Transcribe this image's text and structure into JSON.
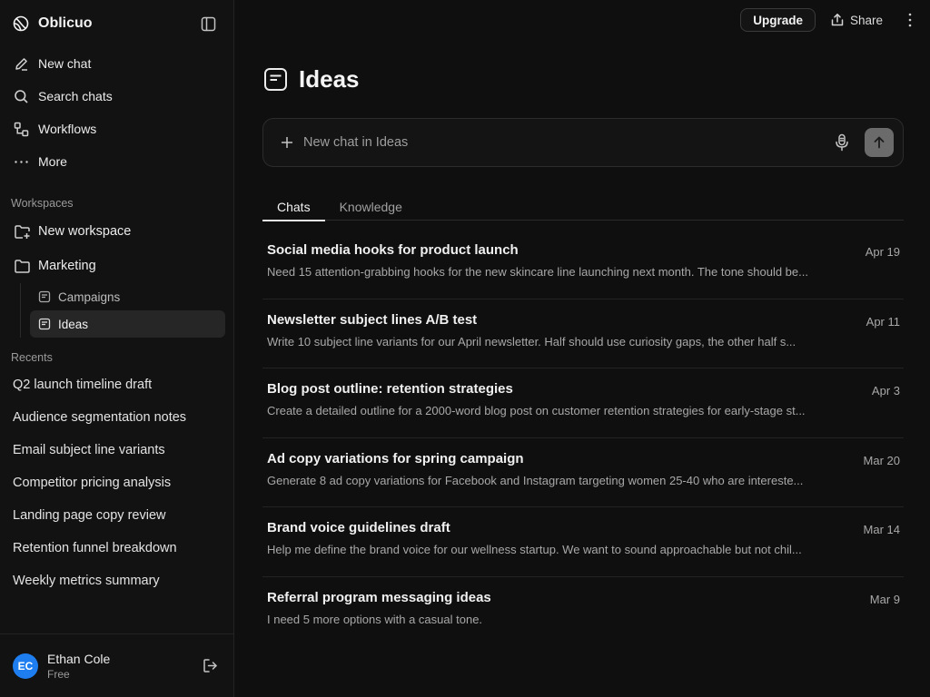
{
  "brand": {
    "name": "Oblicuo"
  },
  "nav": [
    {
      "id": "new-chat",
      "label": "New chat",
      "icon": "pencil-icon"
    },
    {
      "id": "search-chats",
      "label": "Search chats",
      "icon": "search-icon"
    },
    {
      "id": "workflows",
      "label": "Workflows",
      "icon": "workflow-icon"
    },
    {
      "id": "more",
      "label": "More",
      "icon": "ellipsis-icon"
    }
  ],
  "workspaces": {
    "label": "Workspaces",
    "new_label": "New workspace",
    "folder_label": "Marketing",
    "children": [
      {
        "label": "Campaigns",
        "active": false
      },
      {
        "label": "Ideas",
        "active": true
      }
    ]
  },
  "recents": {
    "label": "Recents",
    "items": [
      "Q2 launch timeline draft",
      "Audience segmentation notes",
      "Email subject line variants",
      "Competitor pricing analysis",
      "Landing page copy review",
      "Retention funnel breakdown",
      "Weekly metrics summary"
    ]
  },
  "user": {
    "initials": "EC",
    "name": "Ethan Cole",
    "plan": "Free",
    "avatar_color": "#1e7ef0"
  },
  "topbar": {
    "upgrade_label": "Upgrade",
    "share_label": "Share"
  },
  "page": {
    "title": "Ideas"
  },
  "composer": {
    "placeholder": "New chat in Ideas"
  },
  "tabs": [
    {
      "label": "Chats",
      "active": true
    },
    {
      "label": "Knowledge",
      "active": false
    }
  ],
  "chats": [
    {
      "title": "Social media hooks for product launch",
      "date": "Apr 19",
      "preview": "Need 15 attention-grabbing hooks for the new skincare line launching next month. The tone should be..."
    },
    {
      "title": "Newsletter subject lines A/B test",
      "date": "Apr 11",
      "preview": "Write 10 subject line variants for our April newsletter. Half should use curiosity gaps, the other half s..."
    },
    {
      "title": "Blog post outline: retention strategies",
      "date": "Apr 3",
      "preview": "Create a detailed outline for a 2000-word blog post on customer retention strategies for early-stage st..."
    },
    {
      "title": "Ad copy variations for spring campaign",
      "date": "Mar 20",
      "preview": "Generate 8 ad copy variations for Facebook and Instagram targeting women 25-40 who are intereste..."
    },
    {
      "title": "Brand voice guidelines draft",
      "date": "Mar 14",
      "preview": "Help me define the brand voice for our wellness startup. We want to sound approachable but not chil..."
    },
    {
      "title": "Referral program messaging ideas",
      "date": "Mar 9",
      "preview": "I need 5 more options with a casual tone."
    }
  ]
}
